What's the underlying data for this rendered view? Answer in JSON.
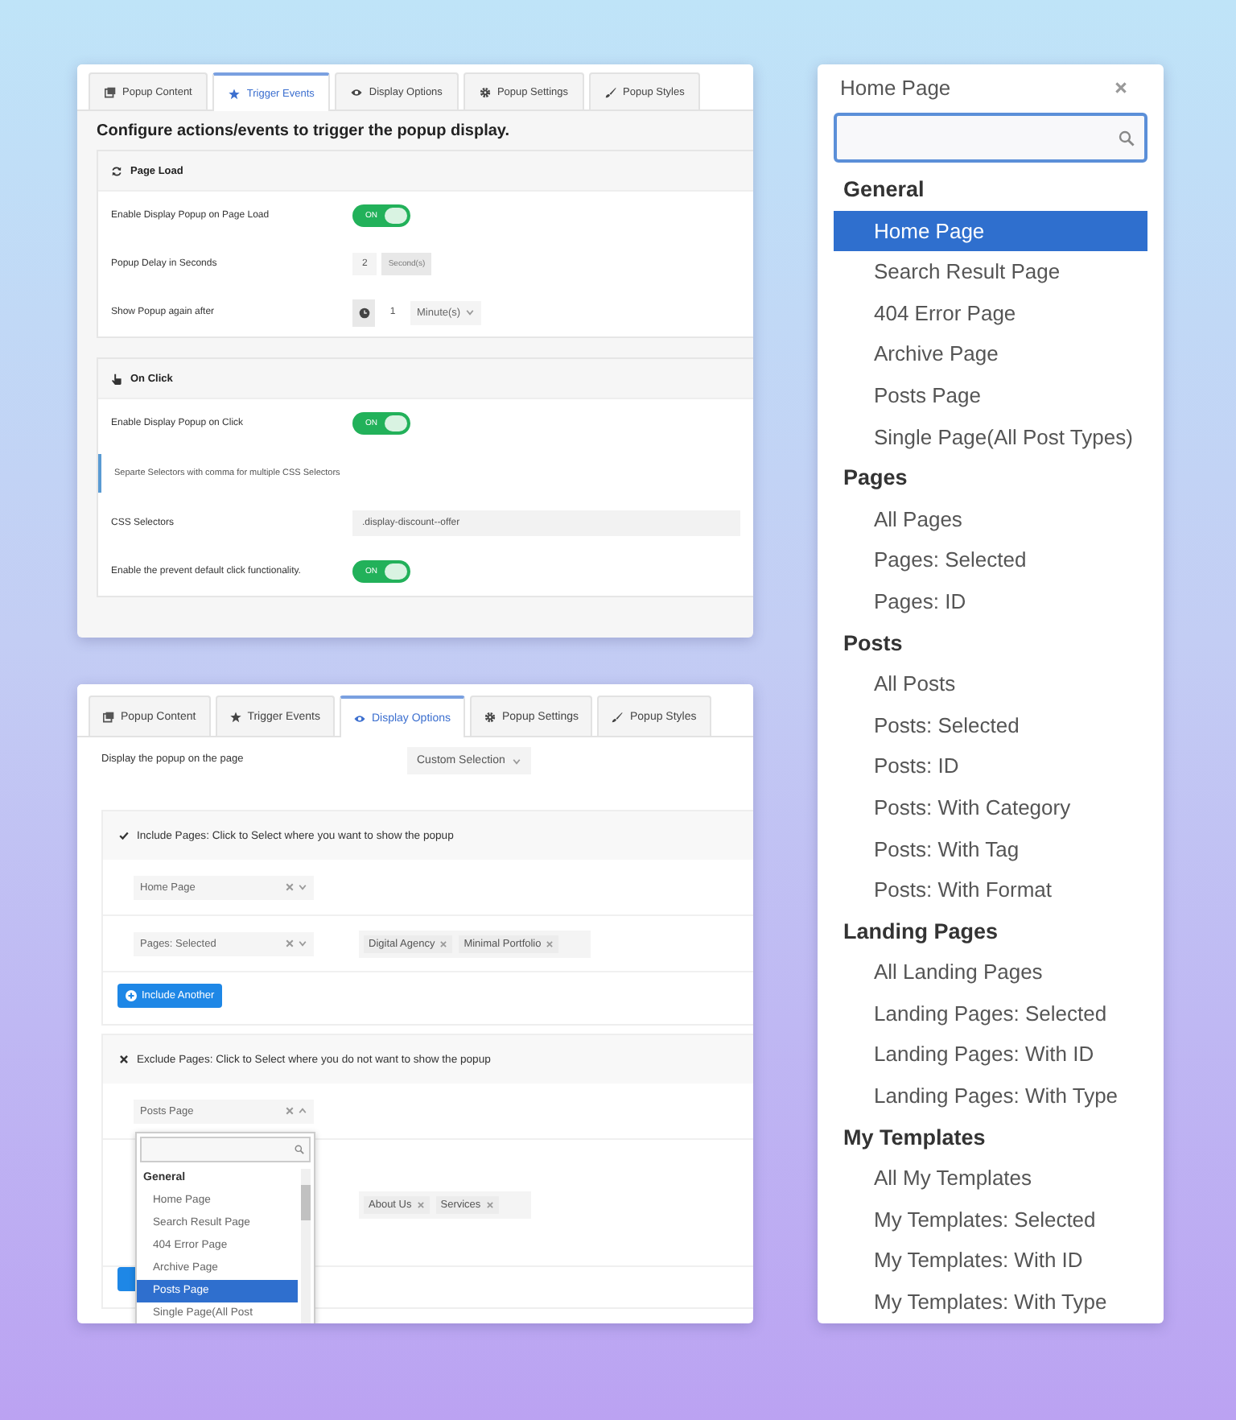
{
  "trigger_panel": {
    "tabs": [
      {
        "label": "Popup Content",
        "selected": false
      },
      {
        "label": "Trigger Events",
        "selected": true
      },
      {
        "label": "Display Options",
        "selected": false
      },
      {
        "label": "Popup Settings",
        "selected": false
      },
      {
        "label": "Popup Styles",
        "selected": false
      }
    ],
    "heading": "Configure actions/events to trigger the popup display.",
    "sections": [
      {
        "title": "Page Load",
        "rows": [
          {
            "kind": "toggle",
            "label": "Enable Display Popup on Page Load",
            "on": true,
            "state_label": "ON"
          },
          {
            "kind": "number",
            "label": "Popup Delay in Seconds",
            "value": "2",
            "unit": "Second(s)"
          },
          {
            "kind": "interval",
            "label": "Show Popup again after",
            "value": "1",
            "unit": "Minute(s)"
          }
        ]
      },
      {
        "title": "On Click",
        "rows": [
          {
            "kind": "toggle",
            "label": "Enable Display Popup on Click",
            "on": true,
            "state_label": "ON"
          },
          {
            "kind": "note",
            "text": "Separte Selectors with comma for multiple CSS Selectors"
          },
          {
            "kind": "text",
            "label": "CSS Selectors",
            "value": ".display-discount--offer"
          },
          {
            "kind": "toggle",
            "label": "Enable the prevent default click functionality.",
            "on": true,
            "state_label": "ON"
          }
        ]
      }
    ]
  },
  "display_panel": {
    "tabs": [
      {
        "label": "Popup Content",
        "selected": false
      },
      {
        "label": "Trigger Events",
        "selected": false
      },
      {
        "label": "Display Options",
        "selected": true
      },
      {
        "label": "Popup Settings",
        "selected": false
      },
      {
        "label": "Popup Styles",
        "selected": false
      }
    ],
    "display_label": "Display the popup on the page",
    "display_select": "Custom Selection",
    "include": {
      "title": "Include Pages: Click to Select where you want to show the popup",
      "rows": [
        {
          "select": "Home Page",
          "expanded": false
        },
        {
          "select": "Pages: Selected",
          "expanded": false,
          "tags": [
            "Digital Agency",
            "Minimal Portfolio"
          ]
        }
      ],
      "button": "Include Another"
    },
    "exclude": {
      "title": "Exclude Pages: Click to Select where you do not want to show the popup",
      "rows": [
        {
          "select": "Posts Page",
          "expanded": true
        },
        {
          "tags": [
            "About Us",
            "Services"
          ]
        }
      ],
      "dropdown": {
        "options": [
          {
            "kind": "group",
            "label": "General"
          },
          {
            "kind": "option",
            "label": "Home Page",
            "selected": false
          },
          {
            "kind": "option",
            "label": "Search Result Page",
            "selected": false
          },
          {
            "kind": "option",
            "label": "404 Error Page",
            "selected": false
          },
          {
            "kind": "option",
            "label": "Archive Page",
            "selected": false
          },
          {
            "kind": "option",
            "label": "Posts Page",
            "selected": true
          },
          {
            "kind": "option",
            "label": "Single Page(All Post",
            "selected": false
          }
        ]
      }
    }
  },
  "selector_panel": {
    "value": "Home Page",
    "options": [
      {
        "kind": "group",
        "label": "General"
      },
      {
        "kind": "option",
        "label": "Home Page",
        "selected": true
      },
      {
        "kind": "option",
        "label": "Search Result Page",
        "selected": false
      },
      {
        "kind": "option",
        "label": "404 Error Page",
        "selected": false
      },
      {
        "kind": "option",
        "label": "Archive Page",
        "selected": false
      },
      {
        "kind": "option",
        "label": "Posts Page",
        "selected": false
      },
      {
        "kind": "option",
        "label": "Single Page(All Post Types)",
        "selected": false
      },
      {
        "kind": "group",
        "label": "Pages"
      },
      {
        "kind": "option",
        "label": "All Pages",
        "selected": false
      },
      {
        "kind": "option",
        "label": "Pages: Selected",
        "selected": false
      },
      {
        "kind": "option",
        "label": "Pages: ID",
        "selected": false
      },
      {
        "kind": "group",
        "label": "Posts"
      },
      {
        "kind": "option",
        "label": "All Posts",
        "selected": false
      },
      {
        "kind": "option",
        "label": "Posts: Selected",
        "selected": false
      },
      {
        "kind": "option",
        "label": "Posts: ID",
        "selected": false
      },
      {
        "kind": "option",
        "label": "Posts: With Category",
        "selected": false
      },
      {
        "kind": "option",
        "label": "Posts: With Tag",
        "selected": false
      },
      {
        "kind": "option",
        "label": "Posts: With Format",
        "selected": false
      },
      {
        "kind": "group",
        "label": "Landing Pages"
      },
      {
        "kind": "option",
        "label": "All Landing Pages",
        "selected": false
      },
      {
        "kind": "option",
        "label": "Landing Pages: Selected",
        "selected": false
      },
      {
        "kind": "option",
        "label": "Landing Pages: With ID",
        "selected": false
      },
      {
        "kind": "option",
        "label": "Landing Pages: With Type",
        "selected": false
      },
      {
        "kind": "group",
        "label": "My Templates"
      },
      {
        "kind": "option",
        "label": "All My Templates",
        "selected": false
      },
      {
        "kind": "option",
        "label": "My Templates: Selected",
        "selected": false
      },
      {
        "kind": "option",
        "label": "My Templates: With ID",
        "selected": false
      },
      {
        "kind": "option",
        "label": "My Templates: With Type",
        "selected": false
      }
    ]
  }
}
